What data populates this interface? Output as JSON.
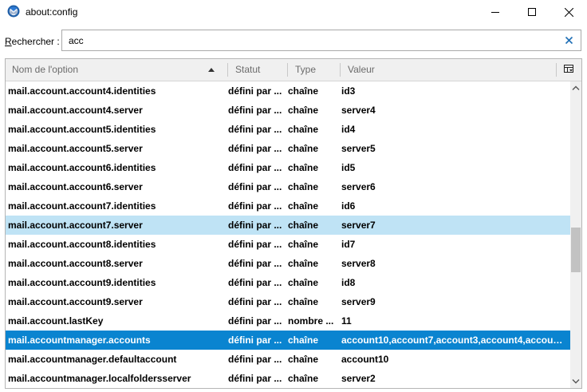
{
  "window": {
    "title": "about:config",
    "icon": "thunderbird-icon",
    "controls": [
      "minimize-icon",
      "maximize-icon",
      "close-icon"
    ]
  },
  "search": {
    "label_accel": "R",
    "label_rest": "echercher :",
    "value": "acc",
    "clear_icon": "clear-x-icon"
  },
  "columns": {
    "name": "Nom de l'option",
    "status": "Statut",
    "type": "Type",
    "value": "Valeur",
    "sort": "ascending"
  },
  "rows": [
    {
      "name": "mail.account.account4.identities",
      "status": "défini par ...",
      "type": "chaîne",
      "value": "id3"
    },
    {
      "name": "mail.account.account4.server",
      "status": "défini par ...",
      "type": "chaîne",
      "value": "server4"
    },
    {
      "name": "mail.account.account5.identities",
      "status": "défini par ...",
      "type": "chaîne",
      "value": "id4"
    },
    {
      "name": "mail.account.account5.server",
      "status": "défini par ...",
      "type": "chaîne",
      "value": "server5"
    },
    {
      "name": "mail.account.account6.identities",
      "status": "défini par ...",
      "type": "chaîne",
      "value": "id5"
    },
    {
      "name": "mail.account.account6.server",
      "status": "défini par ...",
      "type": "chaîne",
      "value": "server6"
    },
    {
      "name": "mail.account.account7.identities",
      "status": "défini par ...",
      "type": "chaîne",
      "value": "id6"
    },
    {
      "name": "mail.account.account7.server",
      "status": "défini par ...",
      "type": "chaîne",
      "value": "server7"
    },
    {
      "name": "mail.account.account8.identities",
      "status": "défini par ...",
      "type": "chaîne",
      "value": "id7"
    },
    {
      "name": "mail.account.account8.server",
      "status": "défini par ...",
      "type": "chaîne",
      "value": "server8"
    },
    {
      "name": "mail.account.account9.identities",
      "status": "défini par ...",
      "type": "chaîne",
      "value": "id8"
    },
    {
      "name": "mail.account.account9.server",
      "status": "défini par ...",
      "type": "chaîne",
      "value": "server9"
    },
    {
      "name": "mail.account.lastKey",
      "status": "défini par ...",
      "type": "nombre ...",
      "value": "11"
    },
    {
      "name": "mail.accountmanager.accounts",
      "status": "défini par ...",
      "type": "chaîne",
      "value": "account10,account7,account3,account4,account..."
    },
    {
      "name": "mail.accountmanager.defaultaccount",
      "status": "défini par ...",
      "type": "chaîne",
      "value": "account10"
    },
    {
      "name": "mail.accountmanager.localfoldersserver",
      "status": "défini par ...",
      "type": "chaîne",
      "value": "server2"
    }
  ],
  "hover_index": 7,
  "selected_index": 13,
  "colors": {
    "hover_row": "#bfe3f5",
    "selected_row": "#0a84d0",
    "header_bg": "#f0f0f0"
  }
}
